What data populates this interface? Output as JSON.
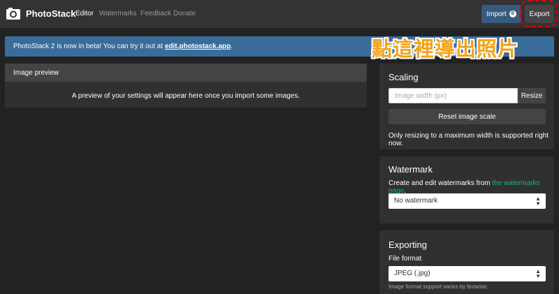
{
  "navbar": {
    "brand": "PhotoStack",
    "links": [
      "Editor",
      "Watermarks",
      "Feedback",
      "Donate"
    ],
    "import_label": "Import",
    "import_count": "0",
    "export_label": "Export"
  },
  "alert": {
    "text": "PhotoStack 2 is now in beta! You can try it out at ",
    "link": "edit.photostack.app",
    "suffix": "."
  },
  "annotation": "點這裡導出照片",
  "preview": {
    "title": "Image preview",
    "message": "A preview of your settings will appear here once you import some images."
  },
  "scaling": {
    "title": "Scaling",
    "placeholder": "Image width (px)",
    "resize_label": "Resize",
    "reset_label": "Reset image scale",
    "note": "Only resizing to a maximum width is supported right now."
  },
  "watermark": {
    "title": "Watermark",
    "text": "Create and edit watermarks from ",
    "link": "the watermarks page",
    "suffix": ".",
    "selected": "No watermark"
  },
  "exporting": {
    "title": "Exporting",
    "format_label": "File format",
    "selected": "JPEG (.jpg)",
    "hint": "Image format support varies by browser."
  },
  "colors": {
    "accent": "#375a7f",
    "alert": "#3a6c9a",
    "link": "#00bc8c",
    "highlight": "#e00000",
    "annotation": "#f5a31a"
  }
}
